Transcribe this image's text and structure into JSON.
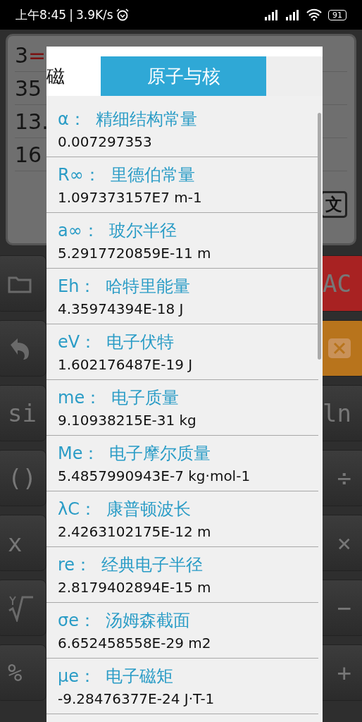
{
  "status_bar": {
    "time": "上午8:45",
    "separator": "|",
    "speed": "3.9K/s",
    "battery": "91"
  },
  "display": {
    "lines": [
      {
        "text": "3",
        "operator": "="
      },
      {
        "text": "35"
      },
      {
        "text": "13."
      },
      {
        "text": "16"
      }
    ],
    "lang_button": "文"
  },
  "keys_left": [
    {
      "kind": "folder"
    },
    {
      "kind": "undo"
    },
    {
      "kind": "text",
      "label": "si"
    },
    {
      "kind": "text",
      "label": "()"
    },
    {
      "kind": "text",
      "label": "x"
    },
    {
      "kind": "root"
    },
    {
      "kind": "text",
      "label": "%"
    }
  ],
  "keys_right": [
    {
      "kind": "text",
      "label": "AC",
      "color": "#a82222"
    },
    {
      "kind": "backspace",
      "color": "#b8741c"
    },
    {
      "kind": "text",
      "label": "ln"
    },
    {
      "kind": "text",
      "label": "÷"
    },
    {
      "kind": "text",
      "label": "×"
    },
    {
      "kind": "text",
      "label": "−"
    },
    {
      "kind": "text",
      "label": "+"
    }
  ],
  "dialog": {
    "tabs": [
      {
        "label": "磁",
        "selected": false
      },
      {
        "label": "原子与核",
        "selected": true
      }
    ],
    "constants": [
      {
        "symbol": "α：",
        "name": "精细结构常量",
        "value": "0.007297353"
      },
      {
        "symbol": "R∞：",
        "name": "里德伯常量",
        "value": "1.097373157E7 m-1"
      },
      {
        "symbol": "a∞：",
        "name": "玻尔半径",
        "value": "5.2917720859E-11 m"
      },
      {
        "symbol": "Eh：",
        "name": "哈特里能量",
        "value": "4.35974394E-18 J"
      },
      {
        "symbol": "eV：",
        "name": "电子伏特",
        "value": "1.602176487E-19 J"
      },
      {
        "symbol": "me：",
        "name": "电子质量",
        "value": "9.10938215E-31 kg"
      },
      {
        "symbol": "Me：",
        "name": "电子摩尔质量",
        "value": "5.4857990943E-7 kg·mol-1"
      },
      {
        "symbol": "λC：",
        "name": "康普顿波长",
        "value": "2.4263102175E-12 m"
      },
      {
        "symbol": "re：",
        "name": "经典电子半径",
        "value": "2.8179402894E-15 m"
      },
      {
        "symbol": "σe：",
        "name": "汤姆森截面",
        "value": "6.652458558E-29 m2"
      },
      {
        "symbol": "μe：",
        "name": "电子磁矩",
        "value": "-9.28476377E-24 J·T-1"
      }
    ]
  }
}
